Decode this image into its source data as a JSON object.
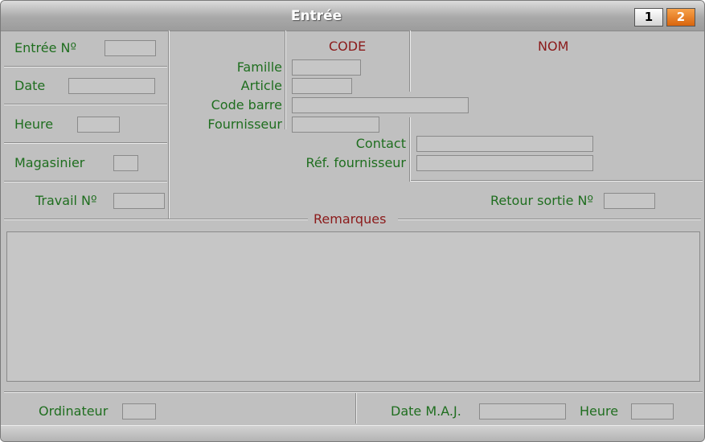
{
  "window": {
    "title": "Entrée"
  },
  "pages": [
    "1",
    "2"
  ],
  "left": {
    "entry_no_label": "Entrée Nº",
    "date_label": "Date",
    "time_label": "Heure",
    "storekeeper_label": "Magasinier",
    "job_no_label": "Travail Nº"
  },
  "columns": {
    "code": "CODE",
    "name": "NOM"
  },
  "item": {
    "family_label": "Famille",
    "article_label": "Article",
    "barcode_label": "Code barre",
    "supplier_label": "Fournisseur",
    "contact_label": "Contact",
    "supplier_ref_label": "Réf. fournisseur",
    "return_exit_label": "Retour sortie Nº"
  },
  "remarks": {
    "legend": "Remarques"
  },
  "footer": {
    "computer_label": "Ordinateur",
    "update_date_label": "Date M.A.J.",
    "update_time_label": "Heure"
  }
}
